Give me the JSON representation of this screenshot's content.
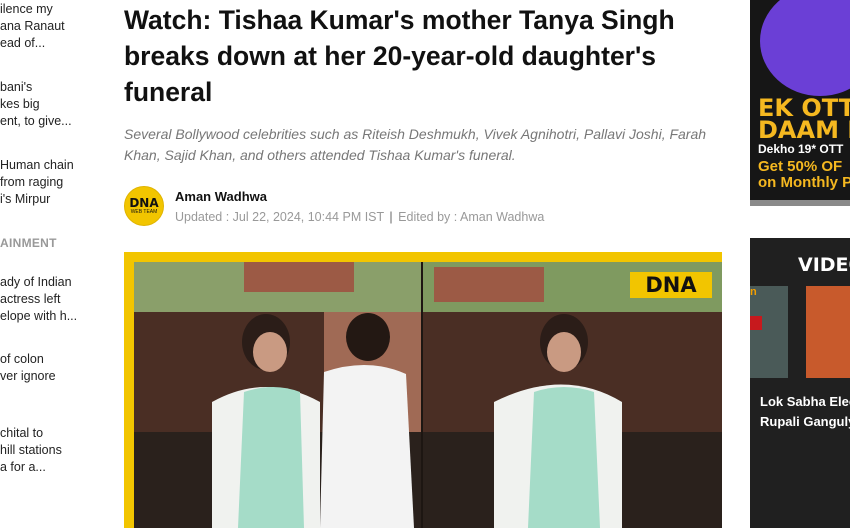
{
  "sidebar": {
    "stories": [
      {
        "lines": [
          "ilence my",
          "ana Ranaut",
          "ead of..."
        ]
      },
      {
        "lines": [
          "bani's",
          "kes big",
          "ent, to give..."
        ]
      },
      {
        "lines": [
          "Human chain",
          "from raging",
          "i's Mirpur"
        ]
      },
      {
        "lines": [
          "ady of Indian",
          "actress left",
          "elope with h..."
        ]
      },
      {
        "lines": [
          "of colon",
          "ver ignore"
        ]
      },
      {
        "lines": [
          "chital to",
          "hill stations",
          "a for a..."
        ]
      }
    ],
    "section_label": "AINMENT"
  },
  "article": {
    "headline": "Watch: Tishaa Kumar's mother Tanya Singh breaks down at her 20-year-old daughter's funeral",
    "subhead": "Several Bollywood celebrities such as Riteish Deshmukh, Vivek Agnihotri, Pallavi Joshi, Farah Khan, Sajid Khan, and others attended Tishaa Kumar's funeral.",
    "author_logo_text": "DNA",
    "author_logo_sub": "WEB TEAM",
    "author": "Aman Wadhwa",
    "updated": "Updated : Jul 22, 2024, 10:44 PM IST",
    "separator": "|",
    "edited_by": "Edited by : Aman Wadhwa",
    "photo_badge": "DNA"
  },
  "ad": {
    "line1": "EK OTT",
    "line2": "DAAM P",
    "line3": "Dekho 19* OTT",
    "line4": "Get 50% OF",
    "line5": "on Monthly P"
  },
  "video": {
    "title": "VIDEO",
    "tag": "n",
    "caption1": "Lok Sabha Elec",
    "caption2": "Rupali Ganguly"
  },
  "colors": {
    "brand_yellow": "#f2c500",
    "ad_yellow": "#f5b820"
  }
}
